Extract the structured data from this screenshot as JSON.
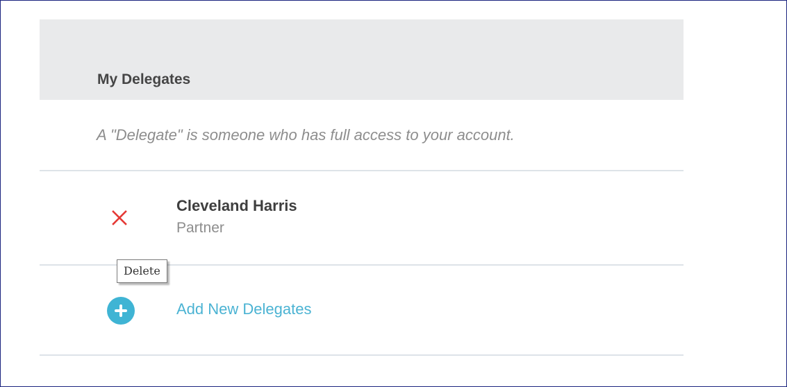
{
  "header": {
    "title": "My Delegates"
  },
  "description": {
    "text": "A \"Delegate\" is someone who has full access to your account."
  },
  "delegates": [
    {
      "name": "Cleveland Harris",
      "role": "Partner",
      "delete_icon": "close-x-icon"
    }
  ],
  "tooltip": {
    "text": "Delete"
  },
  "add": {
    "label": "Add New Delegates",
    "icon": "plus-circle-icon"
  },
  "colors": {
    "header_bg": "#e9eaeb",
    "delete_red": "#e53935",
    "link_blue": "#4bb3d3",
    "add_icon_bg": "#3fb4d4",
    "divider": "#dde3e8",
    "frame_border": "#1a237e"
  }
}
